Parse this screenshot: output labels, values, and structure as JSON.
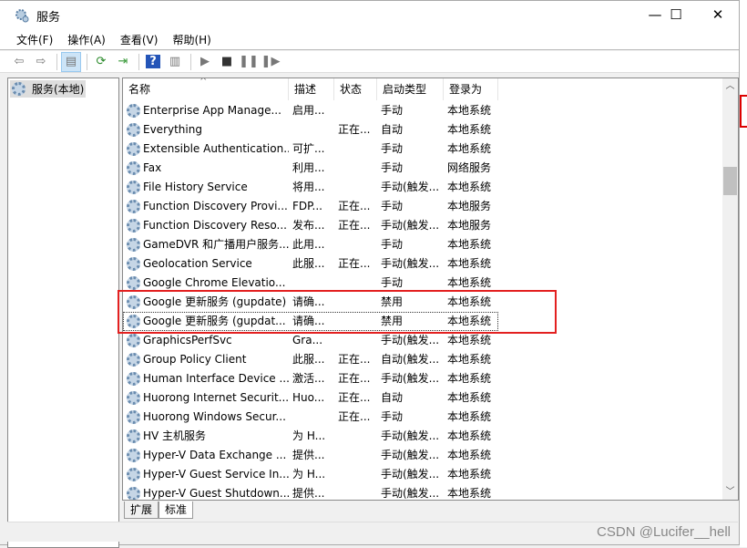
{
  "window": {
    "title": "服务",
    "minimize": "—",
    "maximize": "☐",
    "close": "✕"
  },
  "menu": [
    "文件(F)",
    "操作(A)",
    "查看(V)",
    "帮助(H)"
  ],
  "toolbar": [
    "back-icon",
    "forward-icon",
    "show-hide-console-tree-icon",
    "refresh-icon",
    "export-list-icon",
    "help-icon",
    "properties-icon",
    "start-icon",
    "stop-icon",
    "pause-icon",
    "restart-icon"
  ],
  "tree": {
    "root": "服务(本地)"
  },
  "columns": [
    "名称",
    "描述",
    "状态",
    "启动类型",
    "登录为"
  ],
  "rows": [
    [
      "Enterprise App Manage...",
      "启用...",
      "",
      "手动",
      "本地系统"
    ],
    [
      "Everything",
      "",
      "正在...",
      "自动",
      "本地系统"
    ],
    [
      "Extensible Authentication...",
      "可扩...",
      "",
      "手动",
      "本地系统"
    ],
    [
      "Fax",
      "利用...",
      "",
      "手动",
      "网络服务"
    ],
    [
      "File History Service",
      "将用...",
      "",
      "手动(触发...",
      "本地系统"
    ],
    [
      "Function Discovery Provi...",
      "FDP...",
      "正在...",
      "手动",
      "本地服务"
    ],
    [
      "Function Discovery Reso...",
      "发布...",
      "正在...",
      "手动(触发...",
      "本地服务"
    ],
    [
      "GameDVR 和广播用户服务...",
      "此用...",
      "",
      "手动",
      "本地系统"
    ],
    [
      "Geolocation Service",
      "此服...",
      "正在...",
      "手动(触发...",
      "本地系统"
    ],
    [
      "Google Chrome Elevatio...",
      "",
      "",
      "手动",
      "本地系统"
    ],
    [
      "Google 更新服务 (gupdate)",
      "请确...",
      "",
      "禁用",
      "本地系统"
    ],
    [
      "Google 更新服务 (gupdat...",
      "请确...",
      "",
      "禁用",
      "本地系统"
    ],
    [
      "GraphicsPerfSvc",
      "Gra...",
      "",
      "手动(触发...",
      "本地系统"
    ],
    [
      "Group Policy Client",
      "此服...",
      "正在...",
      "自动(触发...",
      "本地系统"
    ],
    [
      "Human Interface Device ...",
      "激活...",
      "正在...",
      "手动(触发...",
      "本地系统"
    ],
    [
      "Huorong Internet Securit...",
      "Huo...",
      "正在...",
      "自动",
      "本地系统"
    ],
    [
      "Huorong Windows Secur...",
      "",
      "正在...",
      "手动",
      "本地系统"
    ],
    [
      "HV 主机服务",
      "为 H...",
      "",
      "手动(触发...",
      "本地系统"
    ],
    [
      "Hyper-V Data Exchange ...",
      "提供...",
      "",
      "手动(触发...",
      "本地系统"
    ],
    [
      "Hyper-V Guest Service In...",
      "为 H...",
      "",
      "手动(触发...",
      "本地系统"
    ],
    [
      "Hyper-V Guest Shutdown...",
      "提供...",
      "",
      "手动(触发...",
      "本地系统"
    ]
  ],
  "tabs": [
    "扩展",
    "标准"
  ],
  "active_tab": "标准",
  "watermark": "CSDN @Lucifer__hell",
  "highlight_color": "#e32020"
}
